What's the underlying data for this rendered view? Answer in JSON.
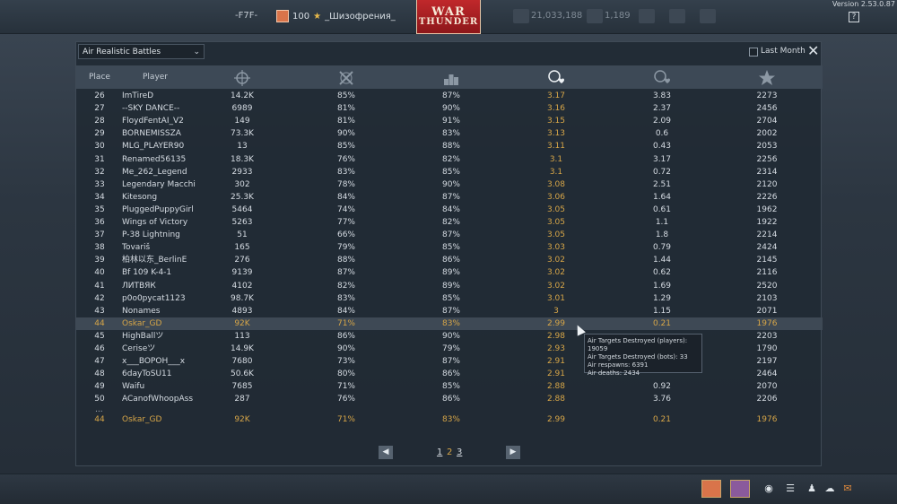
{
  "topbar": {
    "squadron_tag": "-F7F-",
    "level": "100",
    "player_name": "_Шизофрения_",
    "logo_line1": "WAR",
    "logo_line2": "THUNDER",
    "currency1": "21,033,188",
    "currency2": "1,189",
    "version": "Version 2.53.0.87"
  },
  "panel": {
    "mode": "Air Realistic Battles",
    "last_month_label": "Last Month",
    "columns": {
      "place": "Place",
      "player": "Player"
    }
  },
  "rows": [
    {
      "place": "26",
      "player": "ImTireD",
      "c1": "14.2K",
      "c2": "85%",
      "c3": "87%",
      "c4": "3.17",
      "c5": "3.83",
      "c6": "2273"
    },
    {
      "place": "27",
      "player": "--SKY DANCE--",
      "c1": "6989",
      "c2": "81%",
      "c3": "90%",
      "c4": "3.16",
      "c5": "2.37",
      "c6": "2456"
    },
    {
      "place": "28",
      "player": "FloydFentAI_V2",
      "c1": "149",
      "c2": "81%",
      "c3": "91%",
      "c4": "3.15",
      "c5": "2.09",
      "c6": "2704"
    },
    {
      "place": "29",
      "player": "BORNEMISSZA",
      "c1": "73.3K",
      "c2": "90%",
      "c3": "83%",
      "c4": "3.13",
      "c5": "0.6",
      "c6": "2002"
    },
    {
      "place": "30",
      "player": "MLG_PLAYER90",
      "c1": "13",
      "c2": "85%",
      "c3": "88%",
      "c4": "3.11",
      "c5": "0.43",
      "c6": "2053"
    },
    {
      "place": "31",
      "player": "Renamed56135",
      "c1": "18.3K",
      "c2": "76%",
      "c3": "82%",
      "c4": "3.1",
      "c5": "3.17",
      "c6": "2256"
    },
    {
      "place": "32",
      "player": "Me_262_Legend",
      "c1": "2933",
      "c2": "83%",
      "c3": "85%",
      "c4": "3.1",
      "c5": "0.72",
      "c6": "2314"
    },
    {
      "place": "33",
      "player": "Legendary Macchi",
      "c1": "302",
      "c2": "78%",
      "c3": "90%",
      "c4": "3.08",
      "c5": "2.51",
      "c6": "2120"
    },
    {
      "place": "34",
      "player": "Kitesong",
      "c1": "25.3K",
      "c2": "84%",
      "c3": "87%",
      "c4": "3.06",
      "c5": "1.64",
      "c6": "2226"
    },
    {
      "place": "35",
      "player": "PluggedPuppyGirl",
      "c1": "5464",
      "c2": "74%",
      "c3": "84%",
      "c4": "3.05",
      "c5": "0.61",
      "c6": "1962"
    },
    {
      "place": "36",
      "player": "Wings of Victory",
      "c1": "5263",
      "c2": "77%",
      "c3": "82%",
      "c4": "3.05",
      "c5": "1.1",
      "c6": "1922"
    },
    {
      "place": "37",
      "player": "P-38 Lightning",
      "c1": "51",
      "c2": "66%",
      "c3": "87%",
      "c4": "3.05",
      "c5": "1.8",
      "c6": "2214"
    },
    {
      "place": "38",
      "player": "Tovariš",
      "c1": "165",
      "c2": "79%",
      "c3": "85%",
      "c4": "3.03",
      "c5": "0.79",
      "c6": "2424"
    },
    {
      "place": "39",
      "player": "柏林以东_BerlinE",
      "c1": "276",
      "c2": "88%",
      "c3": "86%",
      "c4": "3.02",
      "c5": "1.44",
      "c6": "2145"
    },
    {
      "place": "40",
      "player": "Bf 109 K-4-1",
      "c1": "9139",
      "c2": "87%",
      "c3": "89%",
      "c4": "3.02",
      "c5": "0.62",
      "c6": "2116"
    },
    {
      "place": "41",
      "player": "ЛИТВЯК",
      "c1": "4102",
      "c2": "82%",
      "c3": "89%",
      "c4": "3.02",
      "c5": "1.69",
      "c6": "2520"
    },
    {
      "place": "42",
      "player": "p0o0pycat1123",
      "c1": "98.7K",
      "c2": "83%",
      "c3": "85%",
      "c4": "3.01",
      "c5": "1.29",
      "c6": "2103"
    },
    {
      "place": "43",
      "player": "Nonames",
      "c1": "4893",
      "c2": "84%",
      "c3": "87%",
      "c4": "3",
      "c5": "1.15",
      "c6": "2071"
    },
    {
      "place": "44",
      "player": "Oskar_GD",
      "c1": "92K",
      "c2": "71%",
      "c3": "83%",
      "c4": "2.99",
      "c5": "0.21",
      "c6": "1976"
    },
    {
      "place": "45",
      "player": "HighBallツ",
      "c1": "113",
      "c2": "86%",
      "c3": "90%",
      "c4": "2.98",
      "c5": "",
      "c6": "2203"
    },
    {
      "place": "46",
      "player": "Ceriseツ",
      "c1": "14.9K",
      "c2": "90%",
      "c3": "79%",
      "c4": "2.93",
      "c5": "",
      "c6": "1790"
    },
    {
      "place": "47",
      "player": "x___BOPOH___x",
      "c1": "7680",
      "c2": "73%",
      "c3": "87%",
      "c4": "2.91",
      "c5": "",
      "c6": "2197"
    },
    {
      "place": "48",
      "player": "6dayToSU11",
      "c1": "50.6K",
      "c2": "80%",
      "c3": "86%",
      "c4": "2.91",
      "c5": "",
      "c6": "2464"
    },
    {
      "place": "49",
      "player": "Waifu",
      "c1": "7685",
      "c2": "71%",
      "c3": "85%",
      "c4": "2.88",
      "c5": "0.92",
      "c6": "2070"
    },
    {
      "place": "50",
      "player": "ACanofWhoopAss",
      "c1": "287",
      "c2": "76%",
      "c3": "86%",
      "c4": "2.88",
      "c5": "3.76",
      "c6": "2206"
    }
  ],
  "dots": "...",
  "self_row": {
    "place": "44",
    "player": "Oskar_GD",
    "c1": "92K",
    "c2": "71%",
    "c3": "83%",
    "c4": "2.99",
    "c5": "0.21",
    "c6": "1976"
  },
  "pager": {
    "p1": "1",
    "p2": "2",
    "p3": "3"
  },
  "tooltip": {
    "l1": "Air Targets Destroyed (players): 19059",
    "l2": "Air Targets Destroyed (bots): 33",
    "l3": "Air respawns: 6391",
    "l4": "Air deaths: 2434"
  },
  "colors": {
    "accent": "#d7a648",
    "highlight_row": "#3e4955",
    "panel": "#212a34"
  }
}
